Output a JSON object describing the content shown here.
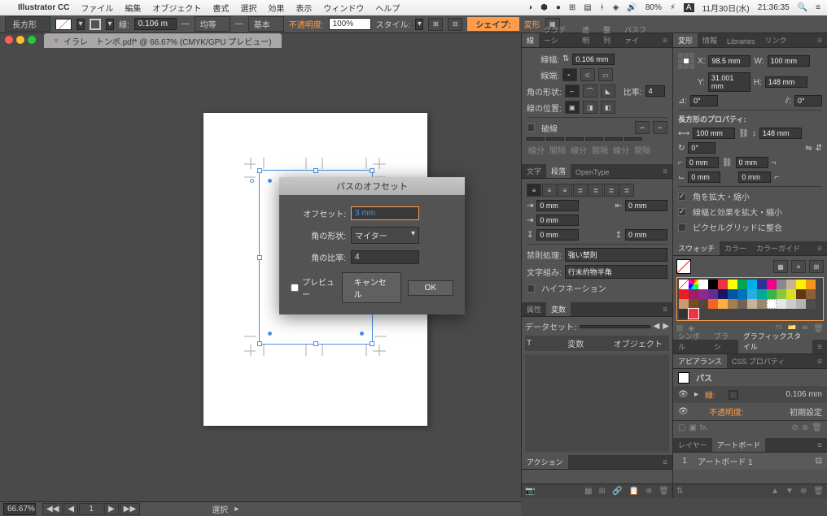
{
  "menubar": {
    "app": "Illustrator CC",
    "items": [
      "ファイル",
      "編集",
      "オブジェクト",
      "書式",
      "選択",
      "効果",
      "表示",
      "ウィンドウ",
      "ヘルプ"
    ],
    "volume": "80%",
    "date": "11月30日(水)",
    "time": "21:36:35",
    "battery_label": "A"
  },
  "controlbar": {
    "shape": "長方形",
    "stroke_label": "線:",
    "stroke": "0.106 m",
    "uniform": "均等",
    "basic": "基本",
    "opacity_label": "不透明度:",
    "opacity": "100%",
    "style_label": "スタイル:",
    "shape_btn": "シェイプ:",
    "transform": "変形"
  },
  "document": {
    "tab": "イラレ　トンボ.pdf* @ 66.67% (CMYK/GPU プレビュー)",
    "zoom": "66.67%"
  },
  "dialog": {
    "title": "パスのオフセット",
    "offset_label": "オフセット:",
    "offset": "3 mm",
    "corner_label": "角の形状:",
    "corner": "マイター",
    "ratio_label": "角の比率:",
    "ratio": "4",
    "preview": "プレビュー",
    "cancel": "キャンセル",
    "ok": "OK"
  },
  "stroke_panel": {
    "tabs": [
      "線",
      "グラデーシ",
      "透明",
      "整列",
      "パスファイ"
    ],
    "weight_label": "線幅:",
    "weight": "0.106 mm",
    "cap_label": "線端:",
    "corner_label": "角の形状:",
    "ratio_label": "比率:",
    "ratio": "4",
    "align_label": "線の位置:",
    "dashed": "破線",
    "dash_labels": [
      "線分",
      "間隔",
      "線分",
      "間隔",
      "線分",
      "間隔"
    ]
  },
  "char_panel": {
    "tabs": [
      "文字",
      "段落",
      "OpenType"
    ],
    "inputs": [
      "0 mm",
      "0 mm",
      "0 mm",
      "0 mm",
      "0 mm",
      "0 mm"
    ],
    "kinsoku_label": "禁則処理:",
    "kinsoku": "強い禁則",
    "kumi_label": "文字組み:",
    "kumi": "行末約物半角",
    "hyphen": "ハイフネーション"
  },
  "attr_panel": {
    "tabs": [
      "属性",
      "変数"
    ],
    "dataset_label": "データセット:",
    "cols": [
      "T",
      "変数",
      "オブジェクト"
    ]
  },
  "actions_panel": {
    "tab": "アクション"
  },
  "transform_panel": {
    "tabs": [
      "変形",
      "情報",
      "Libraries",
      "リンク"
    ],
    "x": "98.5 mm",
    "y": "31.001 mm",
    "w": "100 mm",
    "h": "148 mm",
    "angle": "0°",
    "shear": "0°",
    "props_label": "長方形のプロパティ:",
    "rw": "100 mm",
    "rh": "148 mm",
    "rot": "0°",
    "corners": [
      "0 mm",
      "0 mm",
      "0 mm",
      "0 mm"
    ],
    "opts": [
      "角を拡大・縮小",
      "線幅と効果を拡大・縮小",
      "ピクセルグリッドに整合"
    ]
  },
  "swatch_panel": {
    "tabs": [
      "スウォッチ",
      "カラー",
      "カラーガイド"
    ]
  },
  "symbol_panel": {
    "tabs": [
      "シンボル",
      "ブラシ",
      "グラフィックスタイル"
    ]
  },
  "appearance_panel": {
    "tabs": [
      "アピアランス",
      "CSS プロパティ"
    ],
    "path": "パス",
    "stroke_label": "線:",
    "stroke": "0.106 mm",
    "opacity_label": "不透明度:",
    "opacity_val": "初期設定"
  },
  "layers_panel": {
    "tabs": [
      "レイヤー",
      "アートボード"
    ],
    "num": "1",
    "name": "アートボード 1"
  },
  "statusbar": {
    "zoom": "66.67%",
    "page": "1",
    "tool": "選択"
  },
  "chart_data": null
}
